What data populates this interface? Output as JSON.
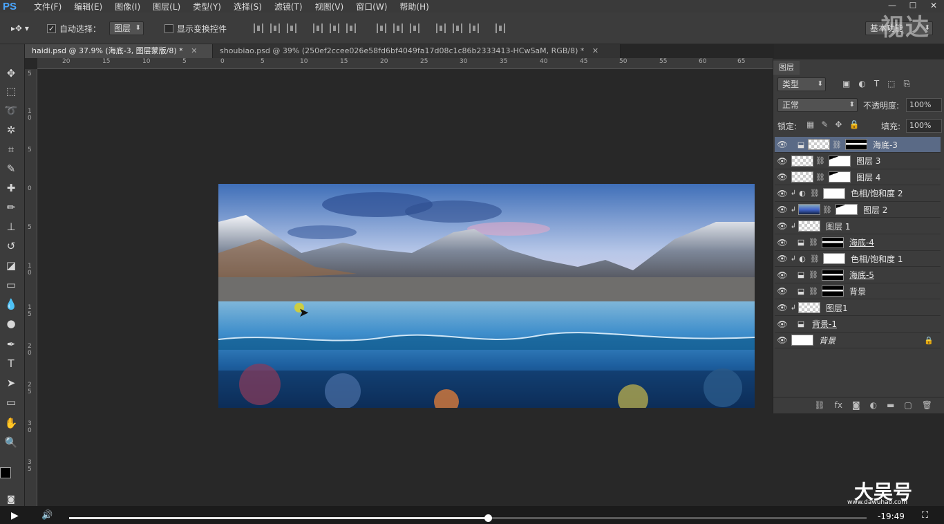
{
  "app": {
    "logo": "PS"
  },
  "menu": [
    "文件(F)",
    "编辑(E)",
    "图像(I)",
    "图层(L)",
    "类型(Y)",
    "选择(S)",
    "滤镜(T)",
    "视图(V)",
    "窗口(W)",
    "帮助(H)"
  ],
  "watermark_top": "视达",
  "options": {
    "auto_select_label": "自动选择：",
    "auto_select_value": "图层",
    "show_transform_label": "显示变换控件",
    "workspace": "基本功能"
  },
  "tabs": [
    {
      "label": "haidi.psd @ 37.9% (海底-3, 图层蒙版/8) *",
      "active": true
    },
    {
      "label": "shoubiao.psd @ 39% (250ef2ccee026e58fd6bf4049fa17d08c1c86b2333413-HCwSaM, RGB/8) *",
      "active": false
    }
  ],
  "ruler_h": [
    "20",
    "15",
    "10",
    "5",
    "0",
    "5",
    "10",
    "15",
    "20",
    "25",
    "30",
    "35",
    "40",
    "45",
    "50",
    "55",
    "60",
    "65"
  ],
  "ruler_v": [
    "5",
    "1\n0",
    "5",
    "0",
    "5",
    "1\n0",
    "1\n5",
    "2\n0",
    "2\n5",
    "3\n0",
    "3\n5"
  ],
  "layers_panel": {
    "title": "图层",
    "filter_kind": "类型",
    "blend_mode": "正常",
    "opacity_label": "不透明度:",
    "opacity_value": "100%",
    "lock_label": "锁定:",
    "fill_label": "填充:",
    "fill_value": "100%",
    "layers": [
      {
        "name": "海底-3",
        "selected": true,
        "underline": false
      },
      {
        "name": "图层 3",
        "selected": false
      },
      {
        "name": "图层 4",
        "selected": false
      },
      {
        "name": "色相/饱和度 2",
        "selected": false
      },
      {
        "name": "图层 2",
        "selected": false
      },
      {
        "name": "图层 1",
        "selected": false
      },
      {
        "name": "海底-4",
        "selected": false,
        "underline": true
      },
      {
        "name": "色相/饱和度 1",
        "selected": false
      },
      {
        "name": "海底-5",
        "selected": false,
        "underline": true
      },
      {
        "name": "背景",
        "selected": false
      },
      {
        "name": "图层1",
        "selected": false
      },
      {
        "name": "背景-1",
        "selected": false,
        "underline": true
      },
      {
        "name": "背景",
        "selected": false,
        "italic": true
      }
    ]
  },
  "video": {
    "time": "-19:49",
    "progress": 0.525,
    "watermark_bottom": "大吴号",
    "watermark_url": "www.dawuhao.com"
  }
}
